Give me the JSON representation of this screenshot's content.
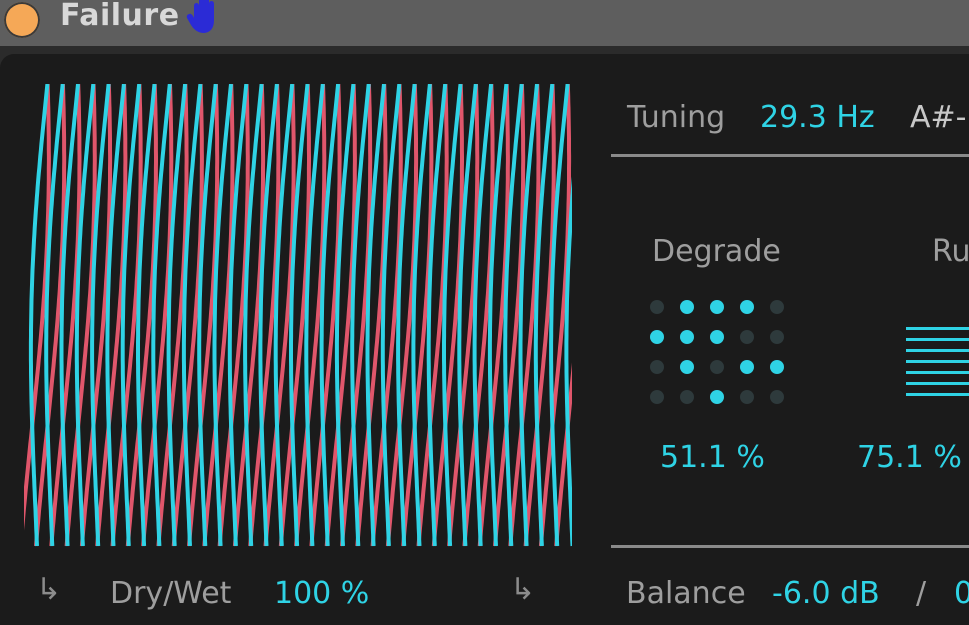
{
  "device": {
    "title": "Failure"
  },
  "tuning": {
    "label": "Tuning",
    "value": "29.3 Hz",
    "note": "A#-"
  },
  "degrade": {
    "label": "Degrade",
    "value": "51.1 %",
    "grid_on": [
      [
        false,
        true,
        true,
        true,
        false
      ],
      [
        true,
        true,
        true,
        false,
        false
      ],
      [
        false,
        true,
        false,
        true,
        true
      ],
      [
        false,
        false,
        true,
        false,
        false
      ]
    ]
  },
  "ruin": {
    "label": "Ru",
    "value": "75.1 %"
  },
  "drywet": {
    "label": "Dry/Wet",
    "value": "100 %"
  },
  "balance": {
    "label": "Balance",
    "value": "-6.0 dB",
    "separator": "/",
    "second_value": "0"
  },
  "colors": {
    "accent": "#2fd3e5",
    "wave_secondary": "#e0566b",
    "power_led": "#f5a857",
    "hand": "#2b2bd6"
  },
  "icons": {
    "power": "power-led-icon",
    "hand": "hand-icon",
    "route": "route-arrow-icon"
  }
}
